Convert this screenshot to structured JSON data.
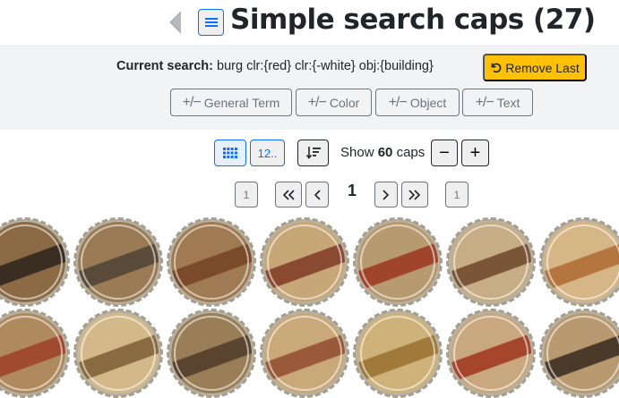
{
  "header": {
    "title": "Simple search caps (27)",
    "back_icon": "chevron-left-icon",
    "menu_icon": "list-icon"
  },
  "search": {
    "label": "Current search:",
    "query": "burg clr:{red} clr:{-white} obj:{building}",
    "remove_last_label": "Remove Last",
    "remove_icon": "undo-icon",
    "filters": [
      {
        "sign": "+/−",
        "label": "General Term"
      },
      {
        "sign": "+/−",
        "label": "Color"
      },
      {
        "sign": "+/−",
        "label": "Object"
      },
      {
        "sign": "+/−",
        "label": "Text"
      }
    ]
  },
  "view": {
    "list_label": "12..",
    "show_prefix": "Show",
    "show_count": "60",
    "show_suffix": "caps",
    "minus_label": "−",
    "plus_label": "+"
  },
  "pagination": {
    "first_page": "1",
    "current_page": "1",
    "last_page": "1"
  },
  "colors": {
    "primary": "#0d6efd",
    "warning": "#ffc107",
    "panel_bg": "#f1f3f5",
    "secondary": "#6c757d"
  },
  "caps": [
    {
      "bg": "#8b6a45",
      "accent": "#3a2d22"
    },
    {
      "bg": "#9a7b55",
      "accent": "#5a4a3a"
    },
    {
      "bg": "#a07a52",
      "accent": "#7a4a2a"
    },
    {
      "bg": "#c7a777",
      "accent": "#8a4a32"
    },
    {
      "bg": "#b89a70",
      "accent": "#a0452c"
    },
    {
      "bg": "#c7ad85",
      "accent": "#7a5538"
    },
    {
      "bg": "#d6b586",
      "accent": "#b4763e"
    },
    {
      "bg": "#b08a5f",
      "accent": "#a04a30"
    },
    {
      "bg": "#d3b98a",
      "accent": "#8a6a40"
    },
    {
      "bg": "#9a7e58",
      "accent": "#5a4430"
    },
    {
      "bg": "#c9a87a",
      "accent": "#9a5a3a"
    },
    {
      "bg": "#cfb27a",
      "accent": "#a07a3a"
    },
    {
      "bg": "#c9a77f",
      "accent": "#a5452c"
    },
    {
      "bg": "#b99a70",
      "accent": "#4a3a2a"
    }
  ]
}
